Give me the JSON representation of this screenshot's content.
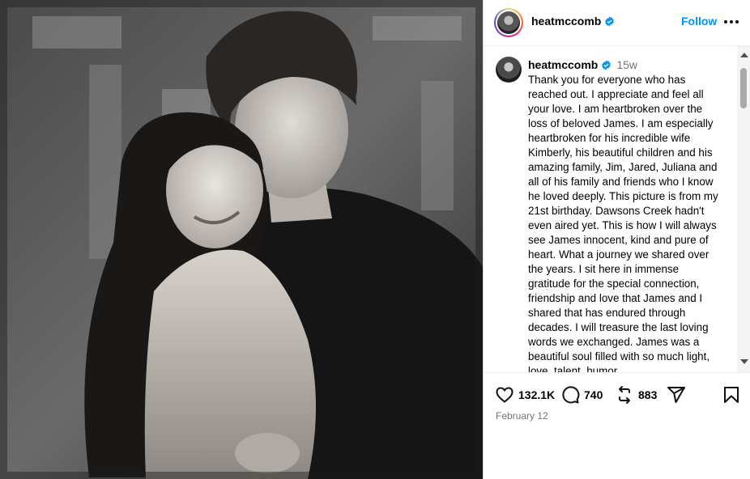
{
  "photo": {
    "alt": "black and white photo"
  },
  "header": {
    "username": "heatmccomb",
    "follow_label": "Follow",
    "avatar_icon": "avatar-icon",
    "verified_icon": "verified-badge-icon",
    "more_icon": "more-options-icon"
  },
  "caption": {
    "username": "heatmccomb",
    "time_ago": "15w",
    "text": "Thank you for everyone who has reached out. I appreciate and feel all your love. I am heartbroken over the loss of beloved James. I am especially heartbroken for his incredible wife Kimberly, his beautiful children and his amazing family, Jim, Jared, Juliana and all of his family and friends who I know he loved deeply. This picture is from my 21st birthday. Dawsons Creek hadn't even aired yet. This is how I will always see James innocent, kind and pure of heart. What a journey we shared over the years. I sit here in immense gratitude for the special connection, friendship and love that James and I shared that has endured through decades. I will treasure the last loving words we exchanged. James was a beautiful soul filled with so much light, love, talent, humor"
  },
  "actions": {
    "likes": "132.1K",
    "comments": "740",
    "reposts": "883",
    "like_icon": "heart-icon",
    "comment_icon": "comment-icon",
    "repost_icon": "repost-icon",
    "share_icon": "share-icon",
    "save_icon": "bookmark-icon"
  },
  "date": "February 12",
  "colors": {
    "accent": "#0095f6",
    "verified": "#0095f6",
    "secondary_text": "#737373"
  }
}
